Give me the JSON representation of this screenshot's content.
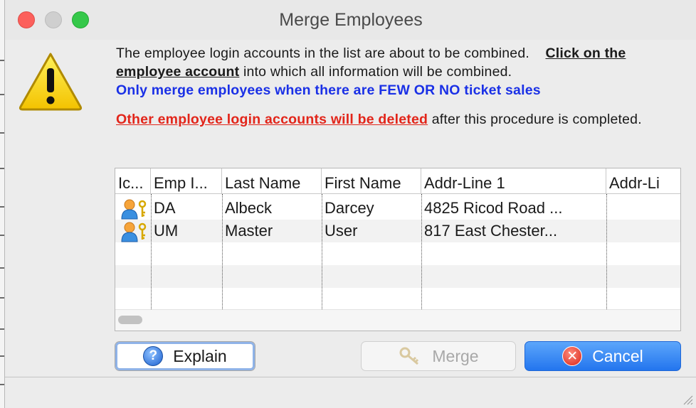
{
  "window": {
    "title": "Merge Employees"
  },
  "message": {
    "line1_text": "The employee login accounts in the list are about to be combined.",
    "line1_link": "Click on the employee account",
    "line1_end": "into which all information will be combined.",
    "warning_blue": "Only merge employees when there are FEW OR NO ticket sales",
    "warning_red": "Other employee login accounts will be deleted",
    "warning_red_end": "after this procedure is completed."
  },
  "table": {
    "columns": [
      "Ic...",
      "Emp I...",
      "Last Name",
      "First Name",
      "Addr-Line 1",
      "Addr-Li"
    ],
    "rows": [
      {
        "icon": "employee-key-icon",
        "emp_id": "DA",
        "last": "Albeck",
        "first": "Darcey",
        "addr1": "4825 Ricod Road ..."
      },
      {
        "icon": "employee-key-icon",
        "emp_id": "UM",
        "last": "Master",
        "first": "User",
        "addr1": "817 East Chester..."
      }
    ]
  },
  "buttons": {
    "explain": "Explain",
    "merge": "Merge",
    "cancel": "Cancel"
  },
  "colors": {
    "blue_text": "#1a30e6",
    "red_text": "#e2251a",
    "cancel_button": "#2375ee"
  }
}
